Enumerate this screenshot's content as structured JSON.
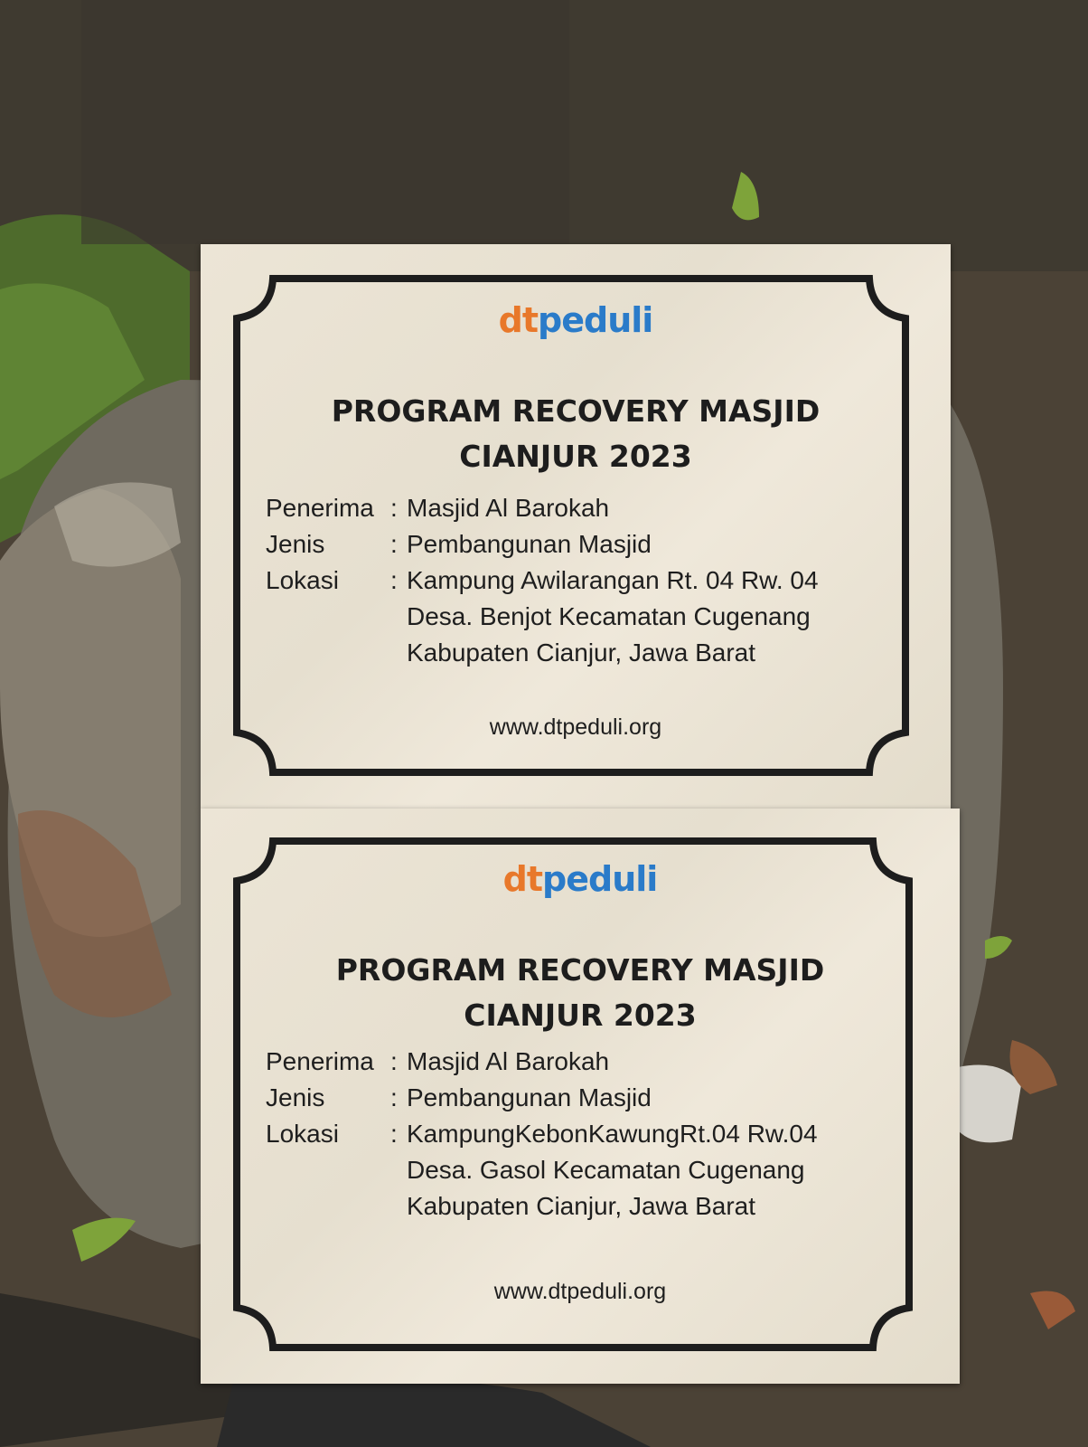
{
  "plaques": [
    {
      "logo": {
        "dt": "dt",
        "peduli": "peduli"
      },
      "title_line1": "PROGRAM RECOVERY MASJID",
      "title_line2": "CIANJUR 2023",
      "penerima_label": "Penerima",
      "penerima_value": "Masjid Al Barokah",
      "jenis_label": "Jenis",
      "jenis_value": "Pembangunan Masjid",
      "lokasi_label": "Lokasi",
      "lokasi_line1": "Kampung Awilarangan Rt. 04 Rw. 04",
      "lokasi_line2": "Desa. Benjot Kecamatan Cugenang",
      "lokasi_line3": "Kabupaten Cianjur, Jawa Barat",
      "website": "www.dtpeduli.org"
    },
    {
      "logo": {
        "dt": "dt",
        "peduli": "peduli"
      },
      "title_line1": "PROGRAM RECOVERY MASJID",
      "title_line2": "CIANJUR 2023",
      "penerima_label": "Penerima",
      "penerima_value": "Masjid Al Barokah",
      "jenis_label": "Jenis",
      "jenis_value": "Pembangunan Masjid",
      "lokasi_label": "Lokasi",
      "lokasi_line1": "KampungKebonKawungRt.04 Rw.04",
      "lokasi_line2": "Desa. Gasol Kecamatan Cugenang",
      "lokasi_line3": "Kabupaten Cianjur, Jawa Barat",
      "website": "www.dtpeduli.org"
    }
  ],
  "colors": {
    "logo_dt": "#e8782a",
    "logo_peduli": "#2a7bc9",
    "engraving": "#1d1d1d",
    "marble": "#ece5d6"
  }
}
